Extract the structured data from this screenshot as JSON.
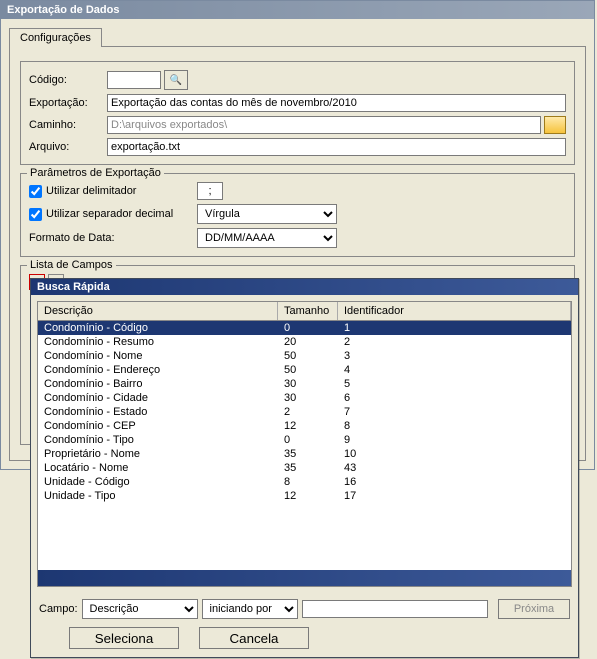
{
  "window": {
    "title": "Exportação de Dados"
  },
  "tabs": {
    "config": "Configurações"
  },
  "config": {
    "code_label": "Código:",
    "code_value": "",
    "export_label": "Exportação:",
    "export_value": "Exportação das contas do mês de novembro/2010",
    "path_label": "Caminho:",
    "path_value": "D:\\arquivos exportados\\",
    "file_label": "Arquivo:",
    "file_value": "exportação.txt"
  },
  "params": {
    "legend": "Parâmetros de Exportação",
    "use_delim_label": "Utilizar delimitador",
    "delim_value": ";",
    "use_decimal_label": "Utilizar separador decimal",
    "decimal_select": "Vírgula",
    "date_format_label": "Formato de Data:",
    "date_format_select": "DD/MM/AAAA"
  },
  "fields": {
    "legend": "Lista de Campos",
    "plus": "+",
    "minus": "-"
  },
  "dialog": {
    "title": "Busca Rápida",
    "headers": {
      "desc": "Descrição",
      "tam": "Tamanho",
      "id": "Identificador"
    },
    "rows": [
      {
        "desc": "Condomínio - Código",
        "tam": "0",
        "id": "1",
        "selected": true
      },
      {
        "desc": "Condomínio - Resumo",
        "tam": "20",
        "id": "2"
      },
      {
        "desc": "Condomínio - Nome",
        "tam": "50",
        "id": "3"
      },
      {
        "desc": "Condomínio - Endereço",
        "tam": "50",
        "id": "4"
      },
      {
        "desc": "Condomínio - Bairro",
        "tam": "30",
        "id": "5"
      },
      {
        "desc": "Condomínio - Cidade",
        "tam": "30",
        "id": "6"
      },
      {
        "desc": "Condomínio - Estado",
        "tam": "2",
        "id": "7"
      },
      {
        "desc": "Condomínio - CEP",
        "tam": "12",
        "id": "8"
      },
      {
        "desc": "Condomínio - Tipo",
        "tam": "0",
        "id": "9"
      },
      {
        "desc": "Proprietário - Nome",
        "tam": "35",
        "id": "10"
      },
      {
        "desc": "Locatário - Nome",
        "tam": "35",
        "id": "43"
      },
      {
        "desc": "Unidade - Código",
        "tam": "8",
        "id": "16"
      },
      {
        "desc": "Unidade - Tipo",
        "tam": "12",
        "id": "17"
      }
    ],
    "campo_label": "Campo:",
    "campo_select": "Descrição",
    "match_select": "iniciando por",
    "match_value": "",
    "next_btn": "Próxima",
    "select_btn": "Seleciona",
    "cancel_btn": "Cancela"
  }
}
